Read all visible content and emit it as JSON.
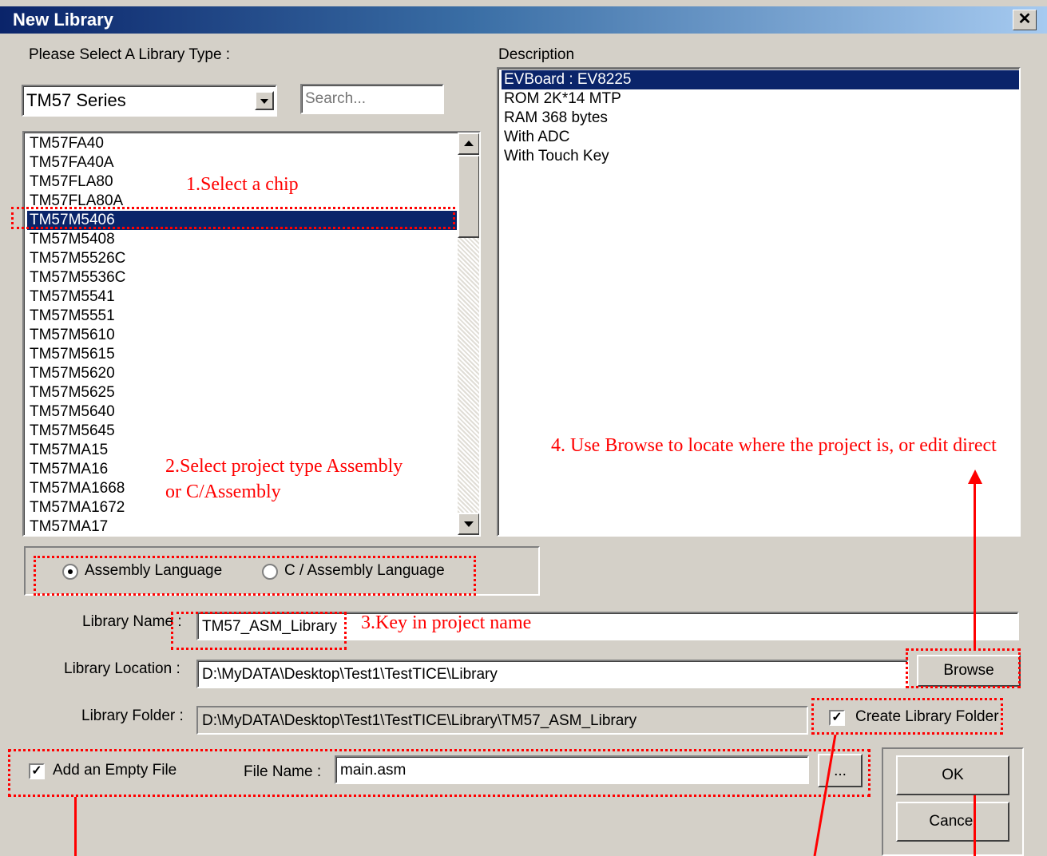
{
  "window": {
    "title": "New Library",
    "close_glyph": "✕"
  },
  "library_type": {
    "label": "Please Select A Library Type :",
    "series_value": "TM57 Series",
    "search_placeholder": "Search...",
    "chips": [
      "TM57FA40",
      "TM57FA40A",
      "TM57FLA80",
      "TM57FLA80A",
      "TM57M5406",
      "TM57M5408",
      "TM57M5526C",
      "TM57M5536C",
      "TM57M5541",
      "TM57M5551",
      "TM57M5610",
      "TM57M5615",
      "TM57M5620",
      "TM57M5625",
      "TM57M5640",
      "TM57M5645",
      "TM57MA15",
      "TM57MA16",
      "TM57MA1668",
      "TM57MA1672",
      "TM57MA17"
    ],
    "selected_chip": "TM57M5406"
  },
  "description": {
    "label": "Description",
    "lines": [
      "EVBoard :  EV8225",
      "ROM 2K*14 MTP",
      "RAM 368 bytes",
      "With ADC",
      "With Touch Key"
    ]
  },
  "language": {
    "assembly_label": "Assembly Language",
    "c_assembly_label": "C / Assembly Language",
    "selected": "assembly"
  },
  "library_name": {
    "label": "Library Name :",
    "value": "TM57_ASM_Library"
  },
  "library_location": {
    "label": "Library Location :",
    "value": "D:\\MyDATA\\Desktop\\Test1\\TestTICE\\Library",
    "browse_label": "Browse"
  },
  "library_folder": {
    "label": "Library Folder :",
    "value": "D:\\MyDATA\\Desktop\\Test1\\TestTICE\\Library\\TM57_ASM_Library",
    "create_label": "Create Library Folder",
    "create_checked": true
  },
  "empty_file": {
    "label": "Add an Empty File",
    "checked": true,
    "file_name_label": "File Name :",
    "file_name_value": "main.asm",
    "ellipsis_label": "..."
  },
  "buttons": {
    "ok": "OK",
    "cancel": "Cancel"
  },
  "annotations": {
    "step1": "1.Select a chip",
    "step2_line1": "2.Select project type Assembly",
    "step2_line2": "or C/Assembly",
    "step3": "3.Key in project name",
    "step4": "4. Use Browse to locate where the project is, or edit direct"
  },
  "colors": {
    "selection": "#0a246a",
    "annotation": "#ff0000",
    "dialog_bg": "#d4d0c8"
  }
}
